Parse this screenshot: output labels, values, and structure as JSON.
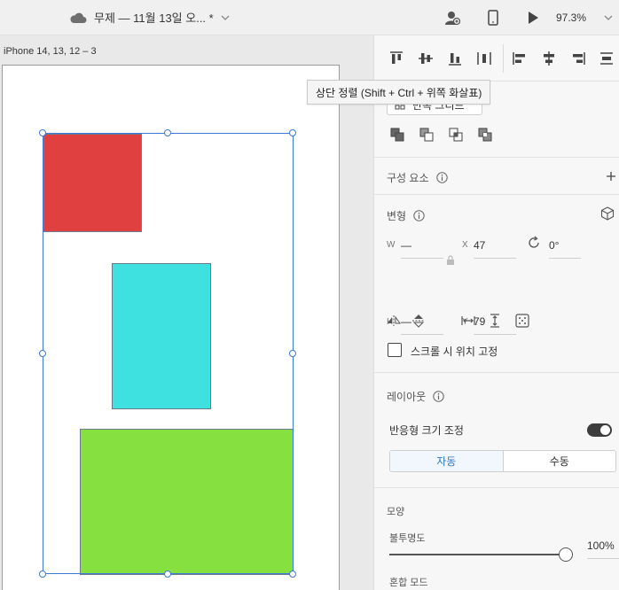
{
  "topbar": {
    "document_title": "무제 — 11월 13일 오... *",
    "zoom": "97.3%"
  },
  "canvas": {
    "artboard_label": "iPhone 14, 13, 12 – 3",
    "shapes": [
      {
        "name": "red-rectangle",
        "color": "#e04040"
      },
      {
        "name": "cyan-rectangle",
        "color": "#3ee0e0"
      },
      {
        "name": "green-rectangle",
        "color": "#86e040"
      }
    ]
  },
  "tooltip": {
    "text": "상단 정렬 (Shift + Ctrl + 위쪽 화살표)"
  },
  "panel": {
    "repeat_grid_label": "반복 그리드",
    "components": {
      "title": "구성 요소"
    },
    "transform": {
      "title": "변형",
      "w_label": "W",
      "w_value": "—",
      "x_label": "X",
      "x_value": "47",
      "rotation_value": "0°",
      "h_label": "H",
      "h_value": "—",
      "y_label": "Y",
      "y_value": "79",
      "fix_position_label": "스크롤 시 위치 고정"
    },
    "layout": {
      "title": "레이아웃",
      "responsive_label": "반응형 크기 조정",
      "responsive_on": true,
      "mode_auto": "자동",
      "mode_manual": "수동"
    },
    "appearance": {
      "title": "모양",
      "opacity_label": "불투명도",
      "opacity_value": "100%",
      "blend_label": "혼합 모드"
    }
  }
}
